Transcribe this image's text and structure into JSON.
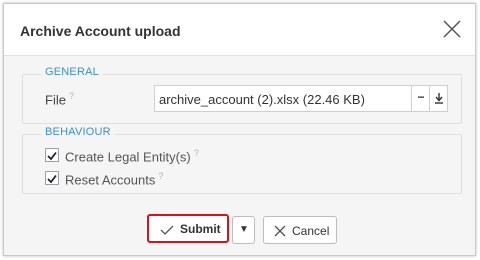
{
  "dialog": {
    "title": "Archive Account upload",
    "close_icon": "close-icon"
  },
  "general": {
    "legend": "GENERAL",
    "file_label": "File",
    "help_mark": "?",
    "file_value": "archive_account (2).xlsx (22.46 KB)",
    "browse_label": "...",
    "download_icon": "download-icon"
  },
  "behaviour": {
    "legend": "BEHAVIOUR",
    "options": [
      {
        "label": "Create Legal Entity(s)",
        "checked": true,
        "help": "?"
      },
      {
        "label": "Reset Accounts",
        "checked": true,
        "help": "?"
      }
    ]
  },
  "footer": {
    "submit_label": "Submit",
    "dropdown_glyph": "▼",
    "cancel_label": "Cancel"
  },
  "colors": {
    "accent": "#3b8fd6",
    "submit_border": "#d8111a",
    "background": "#f5f5f5"
  }
}
